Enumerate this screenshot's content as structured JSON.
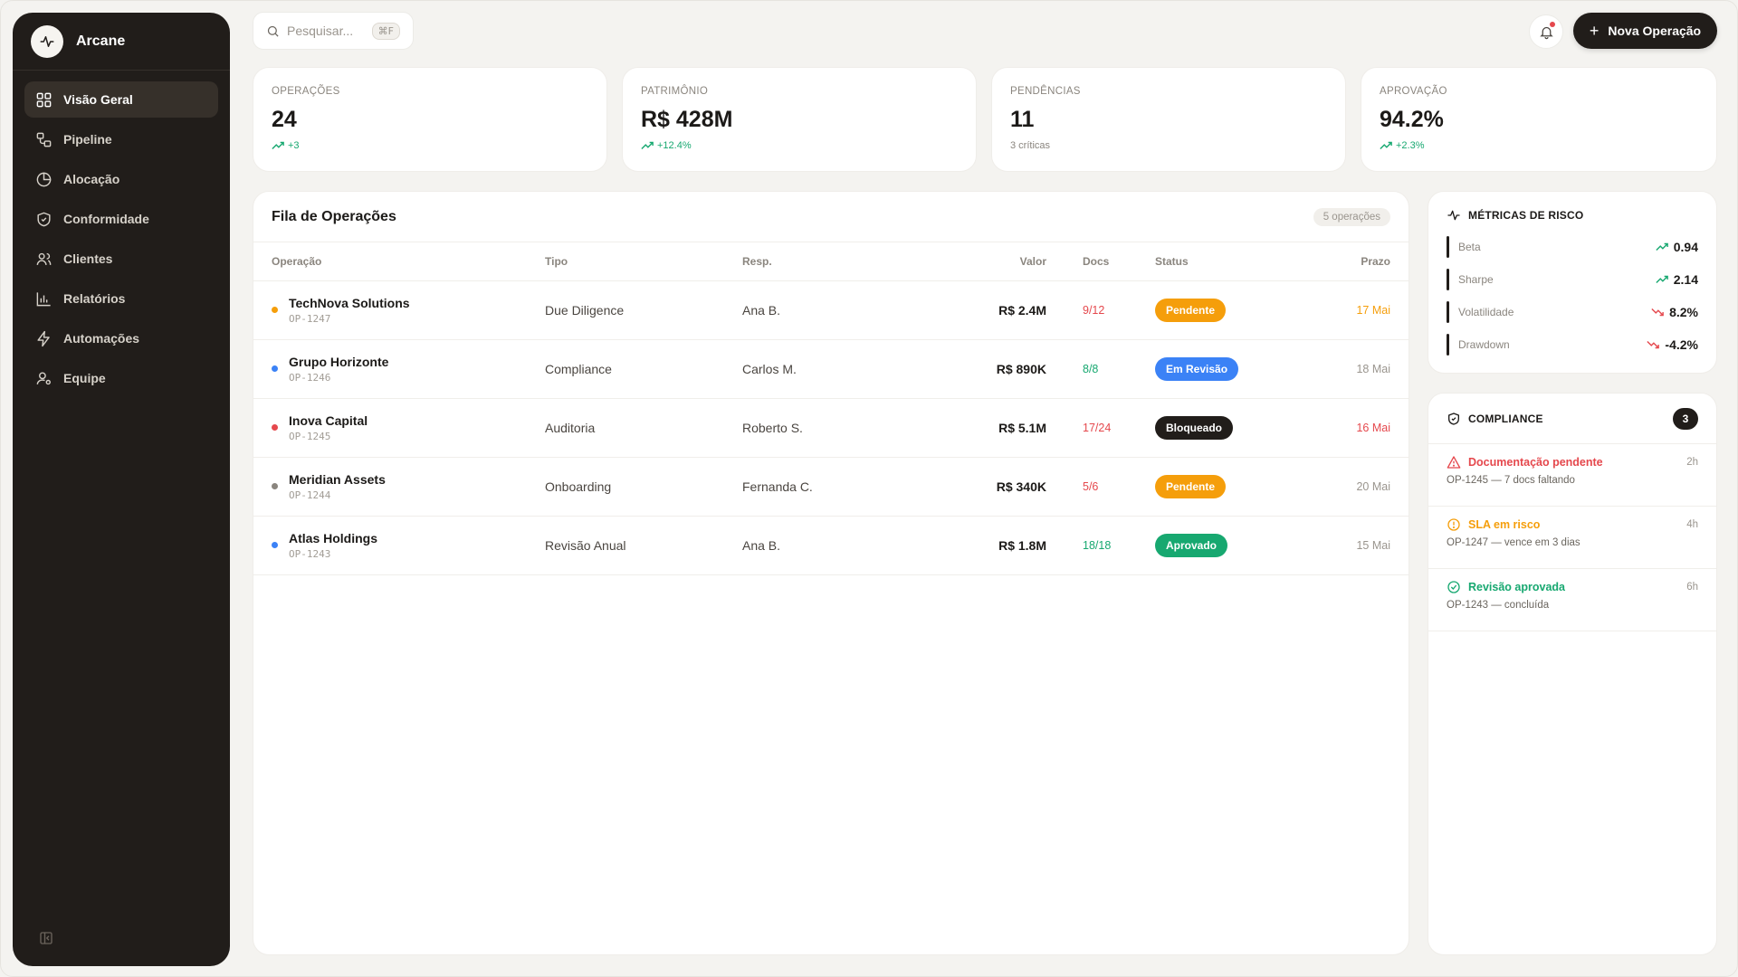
{
  "app": {
    "name": "Arcane"
  },
  "sidebar": {
    "items": [
      {
        "label": "Visão Geral",
        "icon": "grid-icon",
        "active": true
      },
      {
        "label": "Pipeline",
        "icon": "pipeline-icon"
      },
      {
        "label": "Alocação",
        "icon": "pie-chart-icon"
      },
      {
        "label": "Conformidade",
        "icon": "shield-check-icon"
      },
      {
        "label": "Clientes",
        "icon": "users-icon"
      },
      {
        "label": "Relatórios",
        "icon": "bar-chart-icon"
      },
      {
        "label": "Automações",
        "icon": "zap-icon"
      },
      {
        "label": "Equipe",
        "icon": "user-gear-icon"
      }
    ]
  },
  "search": {
    "placeholder": "Pesquisar...",
    "shortcut": "⌘F"
  },
  "header": {
    "new_button": "Nova Operação"
  },
  "kpis": [
    {
      "label": "OPERAÇÕES",
      "value": "24",
      "sub": "+3",
      "trend": "up"
    },
    {
      "label": "PATRIMÔNIO",
      "value": "R$ 428M",
      "sub": "+12.4%",
      "trend": "up"
    },
    {
      "label": "PENDÊNCIAS",
      "value": "11",
      "sub": "3 críticas",
      "trend": "none"
    },
    {
      "label": "APROVAÇÃO",
      "value": "94.2%",
      "sub": "+2.3%",
      "trend": "up"
    }
  ],
  "queue": {
    "title": "Fila de Operações",
    "count": "5 operações",
    "columns": [
      "Operação",
      "Tipo",
      "Resp.",
      "Valor",
      "Docs",
      "Status",
      "Prazo"
    ],
    "rows": [
      {
        "name": "TechNova Solutions",
        "id": "OP-1247",
        "type": "Due Diligence",
        "resp": "Ana B.",
        "value": "R$ 2.4M",
        "docs": "9/12",
        "status": "Pendente",
        "deadline": "17 Mai",
        "dot": "#f59e0b",
        "docs_color": "#e5484d",
        "status_color": "#f59e0b",
        "deadline_color": "#f59e0b"
      },
      {
        "name": "Grupo Horizonte",
        "id": "OP-1246",
        "type": "Compliance",
        "resp": "Carlos M.",
        "value": "R$ 890K",
        "docs": "8/8",
        "status": "Em Revisão",
        "deadline": "18 Mai",
        "dot": "#3b82f6",
        "docs_color": "#17a870",
        "status_color": "#3b82f6",
        "deadline_color": "#9a958e"
      },
      {
        "name": "Inova Capital",
        "id": "OP-1245",
        "type": "Auditoria",
        "resp": "Roberto S.",
        "value": "R$ 5.1M",
        "docs": "17/24",
        "status": "Bloqueado",
        "deadline": "16 Mai",
        "dot": "#e5484d",
        "docs_color": "#e5484d",
        "status_color": "#211d1a",
        "deadline_color": "#e5484d"
      },
      {
        "name": "Meridian Assets",
        "id": "OP-1244",
        "type": "Onboarding",
        "resp": "Fernanda C.",
        "value": "R$ 340K",
        "docs": "5/6",
        "status": "Pendente",
        "deadline": "20 Mai",
        "dot": "#8a857e",
        "docs_color": "#e5484d",
        "status_color": "#f59e0b",
        "deadline_color": "#9a958e"
      },
      {
        "name": "Atlas Holdings",
        "id": "OP-1243",
        "type": "Revisão Anual",
        "resp": "Ana B.",
        "value": "R$ 1.8M",
        "docs": "18/18",
        "status": "Aprovado",
        "deadline": "15 Mai",
        "dot": "#3b82f6",
        "docs_color": "#17a870",
        "status_color": "#17a870",
        "deadline_color": "#9a958e"
      }
    ]
  },
  "risk": {
    "title": "MÉTRICAS DE RISCO",
    "metrics": [
      {
        "label": "Beta",
        "value": "0.94",
        "trend": "up"
      },
      {
        "label": "Sharpe",
        "value": "2.14",
        "trend": "up"
      },
      {
        "label": "Volatilidade",
        "value": "8.2%",
        "trend": "down"
      },
      {
        "label": "Drawdown",
        "value": "-4.2%",
        "trend": "down"
      }
    ]
  },
  "compliance": {
    "title": "COMPLIANCE",
    "count": "3",
    "items": [
      {
        "title": "Documentação pendente",
        "desc": "OP-1245 — 7 docs faltando",
        "time": "2h",
        "color": "#e5484d",
        "icon": "alert-triangle-icon"
      },
      {
        "title": "SLA em risco",
        "desc": "OP-1247 — vence em 3 dias",
        "time": "4h",
        "color": "#f59e0b",
        "icon": "alert-circle-icon"
      },
      {
        "title": "Revisão aprovada",
        "desc": "OP-1243 — concluída",
        "time": "6h",
        "color": "#17a870",
        "icon": "check-circle-icon"
      }
    ]
  },
  "colors": {
    "sidebar_bg": "#211d1a",
    "accent_up": "#17a870",
    "accent_down": "#e5484d",
    "warning": "#f59e0b",
    "info": "#3b82f6"
  }
}
